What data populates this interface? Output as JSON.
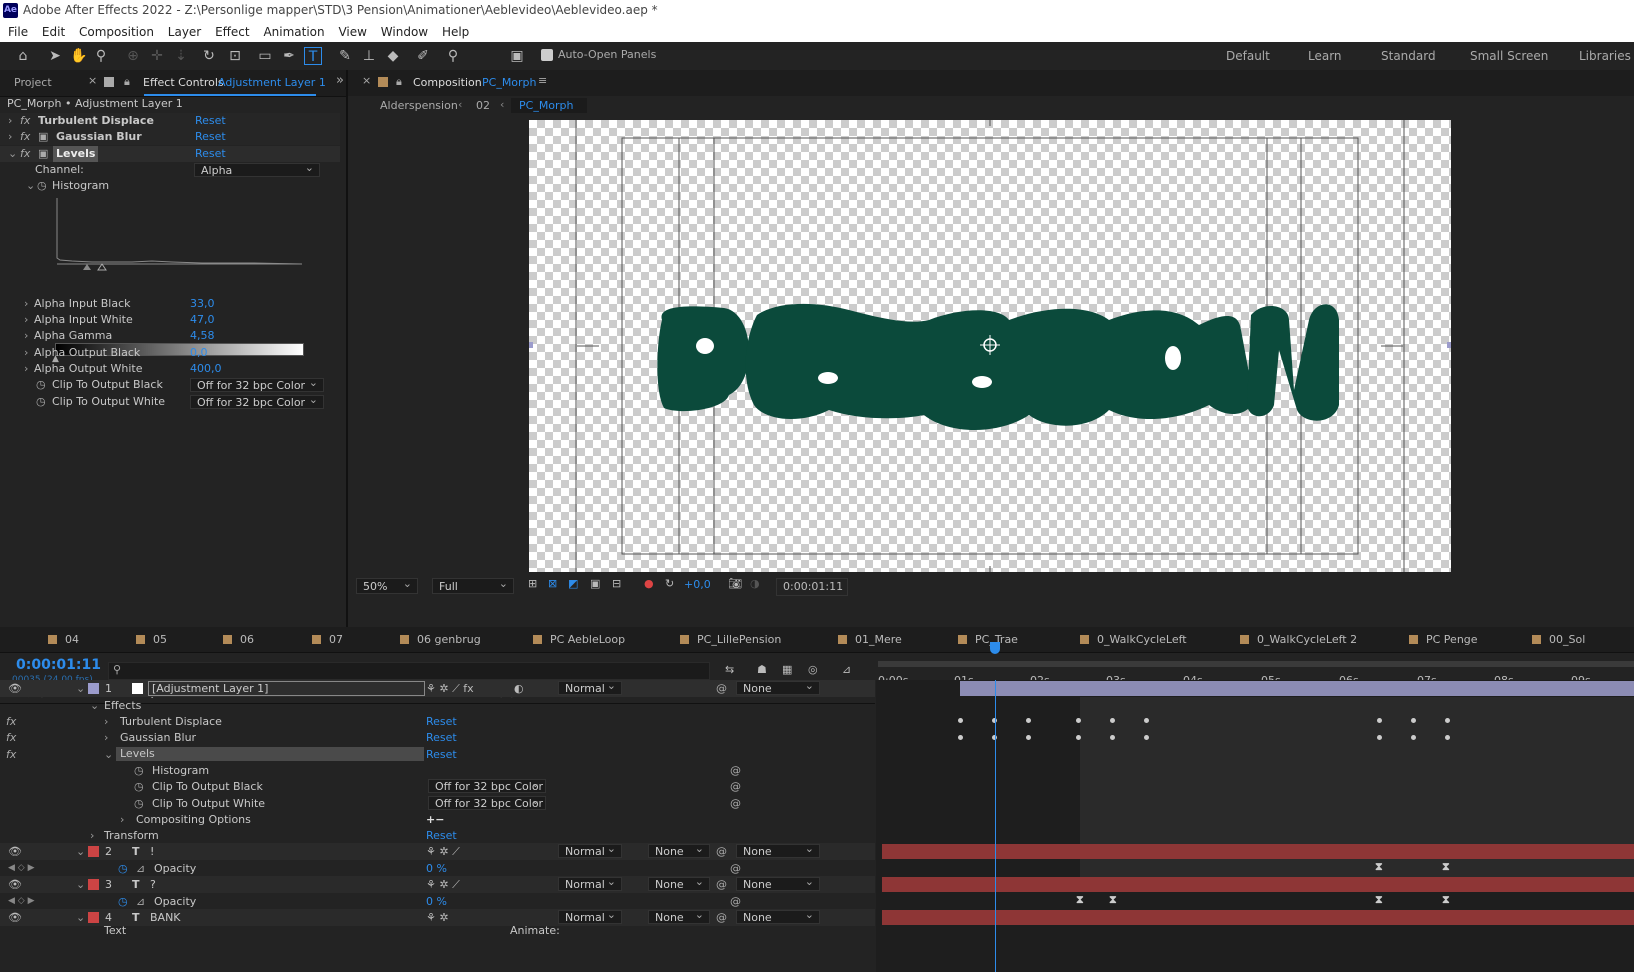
{
  "title_bar": {
    "app_icon": "Ae",
    "title": "Adobe After Effects 2022 - Z:\\Personlige mapper\\STD\\3 Pension\\Animationer\\Aeblevideo\\Aeblevideo.aep *"
  },
  "menu": [
    "File",
    "Edit",
    "Composition",
    "Layer",
    "Effect",
    "Animation",
    "View",
    "Window",
    "Help"
  ],
  "toolbar": {
    "auto_open_label": "Auto-Open Panels",
    "workspaces": [
      "Default",
      "Learn",
      "Standard",
      "Small Screen",
      "Libraries"
    ]
  },
  "left_panel": {
    "tab_project": "Project",
    "tab_effect_controls": "Effect Controls",
    "tab_effect_target": "Adjustment Layer 1",
    "header": "PC_Morph • Adjustment Layer 1",
    "effects": [
      {
        "name": "Turbulent Displace",
        "reset": "Reset"
      },
      {
        "name": "Gaussian Blur",
        "reset": "Reset"
      },
      {
        "name": "Levels",
        "reset": "Reset"
      }
    ],
    "channel_label": "Channel:",
    "channel_value": "Alpha",
    "histogram_label": "Histogram",
    "params": [
      {
        "label": "Alpha Input Black",
        "value": "33,0"
      },
      {
        "label": "Alpha Input White",
        "value": "47,0"
      },
      {
        "label": "Alpha Gamma",
        "value": "4,58"
      },
      {
        "label": "Alpha Output Black",
        "value": "0,0"
      },
      {
        "label": "Alpha Output White",
        "value": "400,0"
      }
    ],
    "clip_black_label": "Clip To Output Black",
    "clip_white_label": "Clip To Output White",
    "clip_value": "Off for 32 bpc Color"
  },
  "comp_panel": {
    "tab_label": "Composition",
    "tab_name": "PC_Morph",
    "breadcrumb_1": "Alderspension",
    "breadcrumb_2": "02",
    "breadcrumb_3": "PC_Morph",
    "text_color": "#0b4a3b",
    "zoom": "50%",
    "resolution": "Full",
    "exposure": "+0,0",
    "timecode": "0:00:01:11"
  },
  "timeline": {
    "comp_tabs": [
      "04",
      "05",
      "06",
      "07",
      "06 genbrug",
      "PC AebleLoop",
      "PC_LillePension",
      "01_Mere",
      "PC_Trae",
      "0_WalkCycleLeft",
      "0_WalkCycleLeft 2",
      "PC Penge",
      "00_Sol"
    ],
    "time": "0:00:01:11",
    "fps": "00035 (24.00 fps)",
    "search_placeholder": "",
    "col_layer_name": "Layer Name",
    "col_mode": "Mode",
    "col_t": "T",
    "col_trkmat": "TrkMat",
    "col_parent": "Parent & Link",
    "ruler": [
      "0:00s",
      "01s",
      "02s",
      "03s",
      "04s",
      "05s",
      "06s",
      "07s",
      "08s",
      "09s"
    ],
    "layer1": {
      "num": "1",
      "name": "[Adjustment Layer 1]",
      "mode": "Normal",
      "parent": "None"
    },
    "effects_label": "Effects",
    "eff_turb": "Turbulent Displace",
    "eff_blur": "Gaussian Blur",
    "eff_levels": "Levels",
    "reset": "Reset",
    "histogram": "Histogram",
    "clip_black": "Clip To Output Black",
    "clip_white": "Clip To Output White",
    "clip_value": "Off for 32 bpc Color",
    "compositing": "Compositing Options",
    "transform": "Transform",
    "layer2": {
      "num": "2",
      "name": "!",
      "mode": "Normal",
      "trkmat": "None",
      "parent": "None"
    },
    "layer3": {
      "num": "3",
      "name": "?",
      "mode": "Normal",
      "trkmat": "None",
      "parent": "None"
    },
    "layer4": {
      "num": "4",
      "name": "BANK",
      "mode": "Normal",
      "trkmat": "None",
      "parent": "None"
    },
    "opacity_label": "Opacity",
    "opacity_value": "0 %",
    "text_label": "Text",
    "animate_label": "Animate:"
  }
}
